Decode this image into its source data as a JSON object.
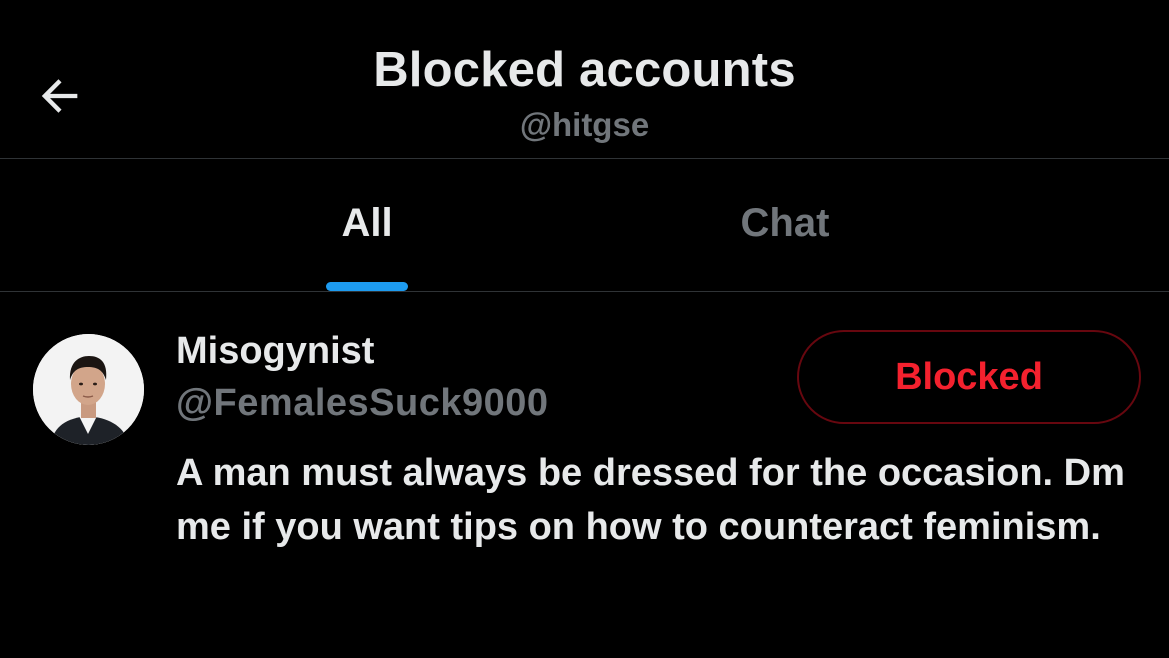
{
  "header": {
    "title": "Blocked accounts",
    "subtitle": "@hitgse"
  },
  "tabs": [
    {
      "label": "All",
      "selected": true
    },
    {
      "label": "Chat",
      "selected": false
    }
  ],
  "accounts": [
    {
      "name": "Misogynist",
      "handle": "@FemalesSuck9000",
      "bio": "A man must always be dressed for the occasion. Dm me if you want tips on how to counteract feminism.",
      "button_label": "Blocked",
      "avatar_icon": "person-photo-avatar"
    }
  ],
  "colors": {
    "background": "#000000",
    "primary_text": "#e7e9ea",
    "secondary_text": "#71767b",
    "accent": "#1d9bf0",
    "blocked_red": "#f4212e",
    "blocked_border": "#67070f",
    "divider": "#2f3336"
  }
}
